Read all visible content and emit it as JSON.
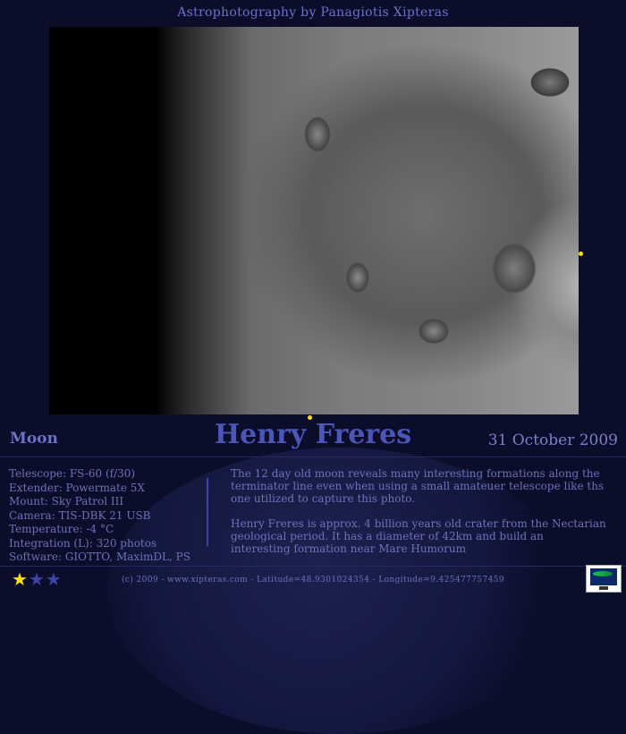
{
  "header": {
    "title": "Astrophotography by Panagiotis Xipteras"
  },
  "title_band": {
    "category": "Moon",
    "title": "Henry Freres",
    "date": "31 October 2009"
  },
  "specs": [
    "Telescope: FS-60 (f/30)",
    "Extender: Powermate 5X",
    "Mount: Sky Patrol III",
    "Camera: TIS-DBK 21 USB",
    "Temperature: -4 °C",
    "Integration (L):  320 photos",
    "Software: GIOTTO, MaximDL, PS"
  ],
  "description": [
    "The 12 day old moon reveals many interesting formations along the terminator  line even when using a small amateuer telescope like ths one utilized to capture this photo.",
    "Henry Freres is approx. 4 billion years old crater from the Nectarian geological period. It has a diameter of 42km and build an interesting formation near Mare Humorum"
  ],
  "rating": {
    "value": 1,
    "max": 3,
    "filled_color": "#ffe100",
    "empty_color": "#3c43a0"
  },
  "footer": {
    "text": "(c) 2009 - www.xipteras.com - Latitude=48.9301024354 - Longitude=9.425477757459"
  },
  "colors": {
    "background": "#0b0d2a",
    "title": "#4c55b8",
    "text": "#6c72b8",
    "marker": "#ffe100"
  }
}
